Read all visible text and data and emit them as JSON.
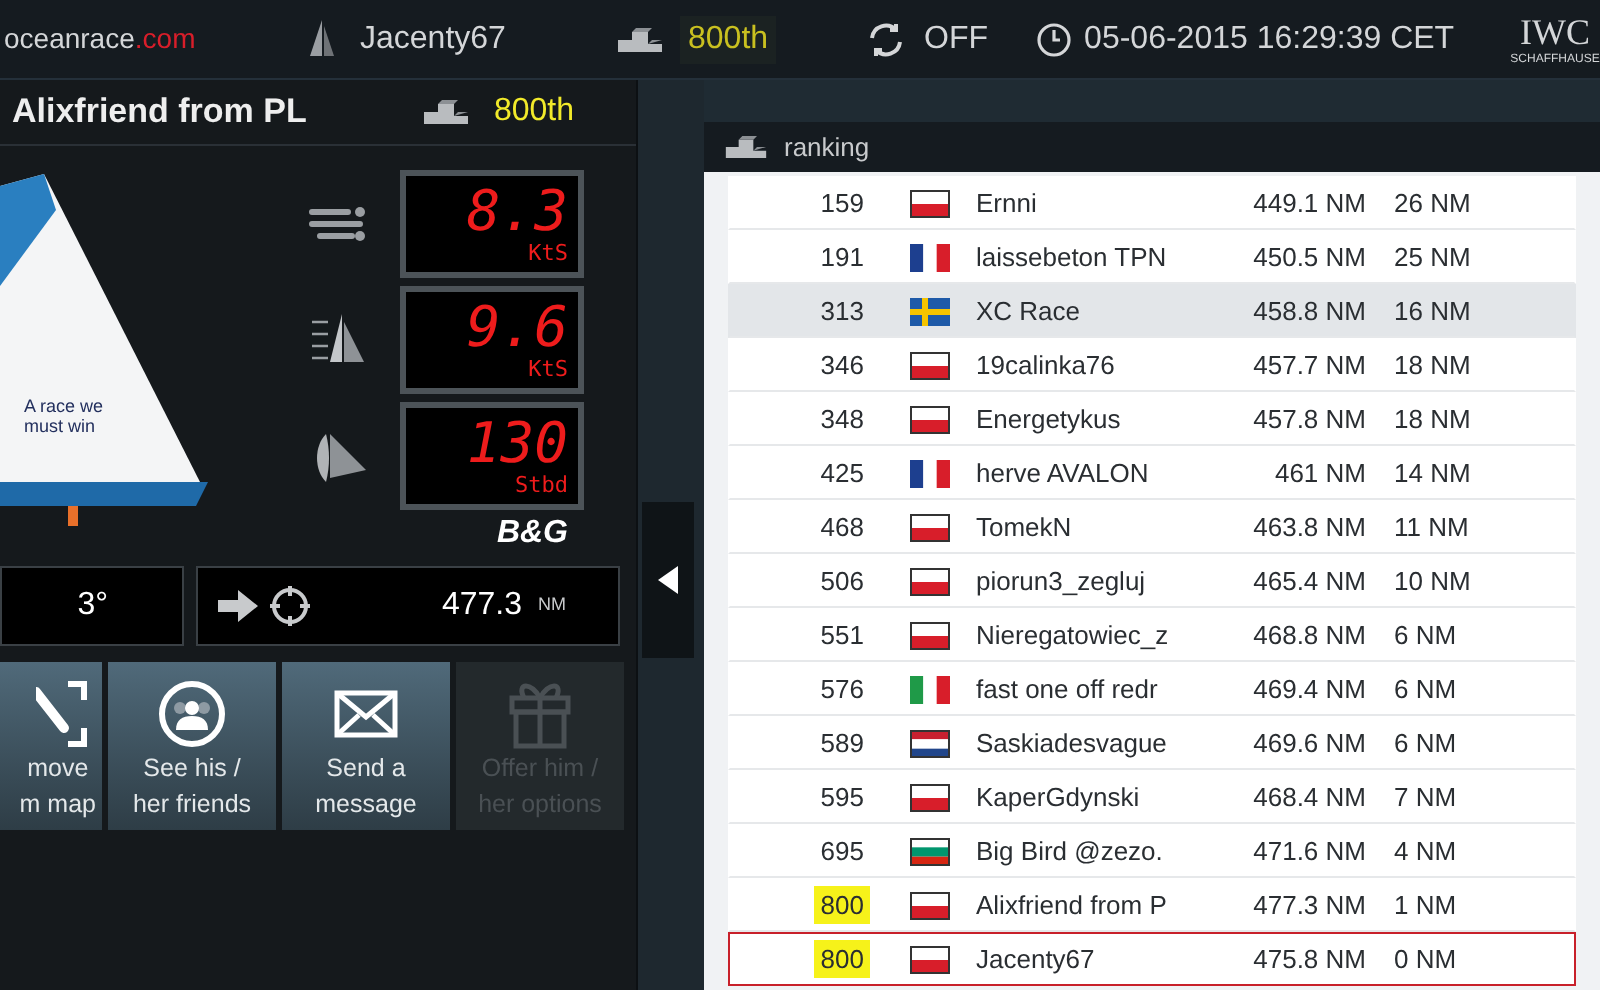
{
  "top_bar": {
    "logo": "oceanrace",
    "logo_suffix": ".com",
    "player": "Jacenty67",
    "rank": "800th",
    "sync": "OFF",
    "datetime": "05-06-2015 16:29:39 CET",
    "sponsor": "IWC",
    "sponsor_sub": "SCHAFFHAUSE"
  },
  "boat_panel": {
    "name": "Alixfriend from PL",
    "rank": "800th",
    "sail_text": "A race we must win",
    "displays": [
      {
        "kind": "wind",
        "value": "8.3",
        "unit": "KtS"
      },
      {
        "kind": "speed",
        "value": "9.6",
        "unit": "KtS"
      },
      {
        "kind": "sail",
        "value": "130",
        "unit": "Stbd"
      }
    ],
    "brand": "B&G",
    "heading": "3°",
    "distance": "477.3",
    "distance_unit": "NM",
    "actions": [
      {
        "kind": "map",
        "label": "move\nm map",
        "disabled": false
      },
      {
        "kind": "friends",
        "label": "See his /\nher friends",
        "disabled": false
      },
      {
        "kind": "message",
        "label": "Send a\nmessage",
        "disabled": false
      },
      {
        "kind": "gift",
        "label": "Offer him /\nher options",
        "disabled": true
      }
    ]
  },
  "ranking": {
    "title": "ranking",
    "rows": [
      {
        "rank": "159",
        "kind": "pl",
        "name": "Ernni",
        "distance": "449.1 NM",
        "gap": "26 NM",
        "selected": false,
        "highlighted": false,
        "outlined": false
      },
      {
        "rank": "191",
        "kind": "fr",
        "name": "laissebeton TPN",
        "distance": "450.5 NM",
        "gap": "25 NM",
        "selected": false,
        "highlighted": false,
        "outlined": false
      },
      {
        "rank": "313",
        "kind": "se",
        "name": "XC Race",
        "distance": "458.8 NM",
        "gap": "16 NM",
        "selected": true,
        "highlighted": false,
        "outlined": false
      },
      {
        "rank": "346",
        "kind": "pl",
        "name": "19calinka76",
        "distance": "457.7 NM",
        "gap": "18 NM",
        "selected": false,
        "highlighted": false,
        "outlined": false
      },
      {
        "rank": "348",
        "kind": "pl",
        "name": "Energetykus",
        "distance": "457.8 NM",
        "gap": "18 NM",
        "selected": false,
        "highlighted": false,
        "outlined": false
      },
      {
        "rank": "425",
        "kind": "fr",
        "name": "herve AVALON",
        "distance": "461 NM",
        "gap": "14 NM",
        "selected": false,
        "highlighted": false,
        "outlined": false
      },
      {
        "rank": "468",
        "kind": "pl",
        "name": "TomekN",
        "distance": "463.8 NM",
        "gap": "11 NM",
        "selected": false,
        "highlighted": false,
        "outlined": false
      },
      {
        "rank": "506",
        "kind": "pl",
        "name": "piorun3_zegluj",
        "distance": "465.4 NM",
        "gap": "10 NM",
        "selected": false,
        "highlighted": false,
        "outlined": false
      },
      {
        "rank": "551",
        "kind": "pl",
        "name": "Nieregatowiec_z",
        "distance": "468.8 NM",
        "gap": "6 NM",
        "selected": false,
        "highlighted": false,
        "outlined": false
      },
      {
        "rank": "576",
        "kind": "it",
        "name": "fast one off redr",
        "distance": "469.4 NM",
        "gap": "6 NM",
        "selected": false,
        "highlighted": false,
        "outlined": false
      },
      {
        "rank": "589",
        "kind": "nl",
        "name": "Saskiadesvague",
        "distance": "469.6 NM",
        "gap": "6 NM",
        "selected": false,
        "highlighted": false,
        "outlined": false
      },
      {
        "rank": "595",
        "kind": "pl",
        "name": "KaperGdynski",
        "distance": "468.4 NM",
        "gap": "7 NM",
        "selected": false,
        "highlighted": false,
        "outlined": false
      },
      {
        "rank": "695",
        "kind": "bg",
        "name": "Big Bird @zezo.",
        "distance": "471.6 NM",
        "gap": "4 NM",
        "selected": false,
        "highlighted": false,
        "outlined": false
      },
      {
        "rank": "800",
        "kind": "pl",
        "name": "Alixfriend from P",
        "distance": "477.3 NM",
        "gap": "1 NM",
        "selected": false,
        "highlighted": true,
        "outlined": false
      },
      {
        "rank": "800",
        "kind": "pl",
        "name": "Jacenty67",
        "distance": "475.8 NM",
        "gap": "0 NM",
        "selected": false,
        "highlighted": true,
        "outlined": true
      }
    ]
  }
}
